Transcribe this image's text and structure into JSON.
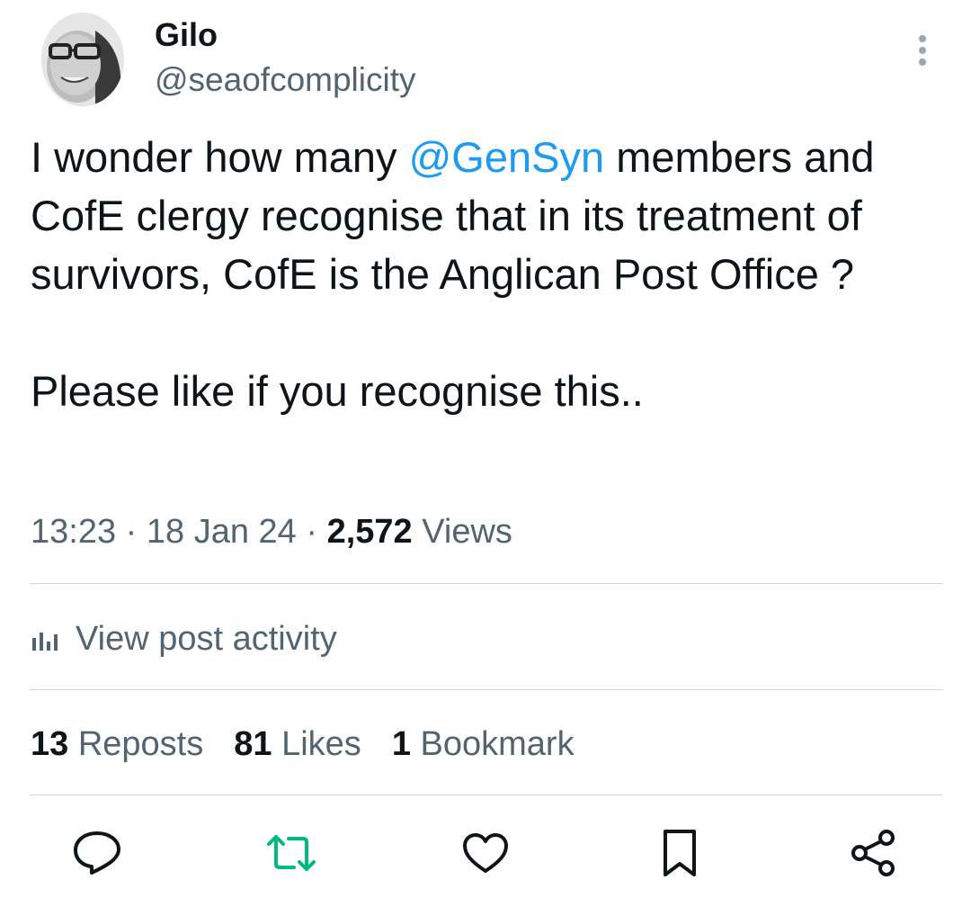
{
  "author": {
    "name": "Gilo",
    "handle": "@seaofcomplicity"
  },
  "post": {
    "text_part1": "I wonder how many ",
    "mention": "@GenSyn",
    "text_part2": " members and CofE clergy recognise that in its treatment of survivors, CofE is the Anglican Post Office ?",
    "text_para2": "Please like if you recognise this.."
  },
  "meta": {
    "time": "13:23",
    "separator": " · ",
    "date": "18 Jan 24",
    "views_count": "2,572",
    "views_label": " Views"
  },
  "activity": {
    "label": "View post activity",
    "icon": "bar-chart-icon"
  },
  "stats": {
    "reposts_count": "13",
    "reposts_label": " Reposts",
    "likes_count": "81",
    "likes_label": " Likes",
    "bookmarks_count": "1",
    "bookmarks_label": " Bookmark"
  },
  "actions": [
    {
      "name": "reply",
      "icon": "reply-icon"
    },
    {
      "name": "repost",
      "icon": "repost-icon",
      "color": "#00ba7c"
    },
    {
      "name": "like",
      "icon": "heart-icon"
    },
    {
      "name": "bookmark",
      "icon": "bookmark-icon"
    },
    {
      "name": "share",
      "icon": "share-icon"
    }
  ],
  "colors": {
    "text": "#0f1419",
    "secondary": "#536471",
    "link": "#1d9bf0",
    "repost_active": "#00ba7c",
    "divider": "#cfd9de"
  }
}
